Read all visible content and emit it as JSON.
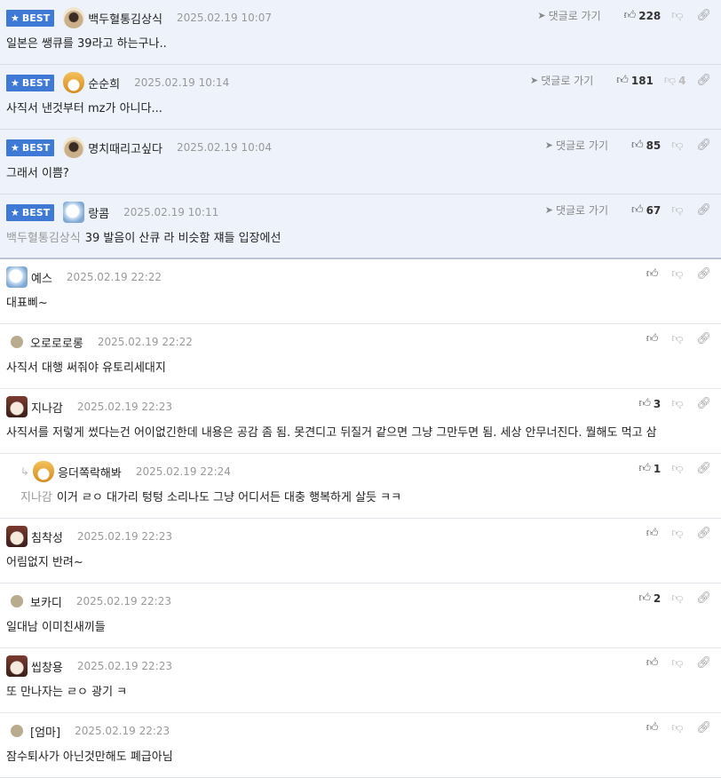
{
  "actions": {
    "goto_label": "댓글로 가기"
  },
  "best_badge": "BEST",
  "best_comments": [
    {
      "avatar": "pug-avatar",
      "nick": "백두혈통김상식",
      "date": "2025.02.19 10:07",
      "text": "일본은 쌩큐를 39라고 하는구나..",
      "mention": "",
      "likes": "228",
      "dislikes": ""
    },
    {
      "avatar": "fox-avatar",
      "nick": "순순희",
      "date": "2025.02.19 10:14",
      "text": "사직서 낸것부터 mz가 아니다...",
      "mention": "",
      "likes": "181",
      "dislikes": "4"
    },
    {
      "avatar": "pug-avatar",
      "nick": "명치때리고싶다",
      "date": "2025.02.19 10:04",
      "text": "그래서 이쁨?",
      "mention": "",
      "likes": "85",
      "dislikes": ""
    },
    {
      "avatar": "ghost-avatar",
      "nick": "랑콤",
      "date": "2025.02.19 10:11",
      "text": "39 발음이 산큐 라 비슷함 쟤들 입장에선",
      "mention": "백두혈통김상식",
      "likes": "67",
      "dislikes": ""
    }
  ],
  "comments": [
    {
      "avatar": "ghost-avatar",
      "nick": "예스",
      "date": "2025.02.19 22:22",
      "text": "대표삐~",
      "mention": "",
      "likes": "",
      "reply": false
    },
    {
      "avatar": "dot-avatar",
      "nick": "오로로로롱",
      "date": "2025.02.19 22:22",
      "text": "사직서 대행 써줘야 유토리세대지",
      "mention": "",
      "likes": "",
      "reply": false
    },
    {
      "avatar": "dog-avatar",
      "nick": "지나감",
      "date": "2025.02.19 22:23",
      "text": "사직서를 저렇게 썼다는건 어이없긴한데 내용은 공감 좀 됨. 못견디고 뒤질거 같으면 그냥 그만두면 됨. 세상 안무너진다. 뭘해도 먹고 삼",
      "mention": "",
      "likes": "3",
      "reply": false
    },
    {
      "avatar": "fox-avatar",
      "nick": "응더쪽락해봐",
      "date": "2025.02.19 22:24",
      "text": "이거 ㄹㅇ 대가리 텅텅 소리나도 그냥 어디서든 대충 행복하게 살듯 ㅋㅋ",
      "mention": "지나감",
      "likes": "1",
      "reply": true
    },
    {
      "avatar": "dog-avatar",
      "nick": "침착성",
      "date": "2025.02.19 22:23",
      "text": "어림없지 반려~",
      "mention": "",
      "likes": "",
      "reply": false
    },
    {
      "avatar": "dot-avatar",
      "nick": "보카디",
      "date": "2025.02.19 22:23",
      "text": "일대남 이미친새끼들",
      "mention": "",
      "likes": "2",
      "reply": false
    },
    {
      "avatar": "dog-avatar",
      "nick": "씹창용",
      "date": "2025.02.19 22:23",
      "text": "또 만나자는 ㄹㅇ 광기 ㅋ",
      "mention": "",
      "likes": "",
      "reply": false
    },
    {
      "avatar": "dot-avatar",
      "nick": "[엄마]",
      "date": "2025.02.19 22:23",
      "text": "잠수퇴사가 아닌것만해도 폐급아님",
      "mention": "",
      "likes": "",
      "reply": false
    }
  ]
}
